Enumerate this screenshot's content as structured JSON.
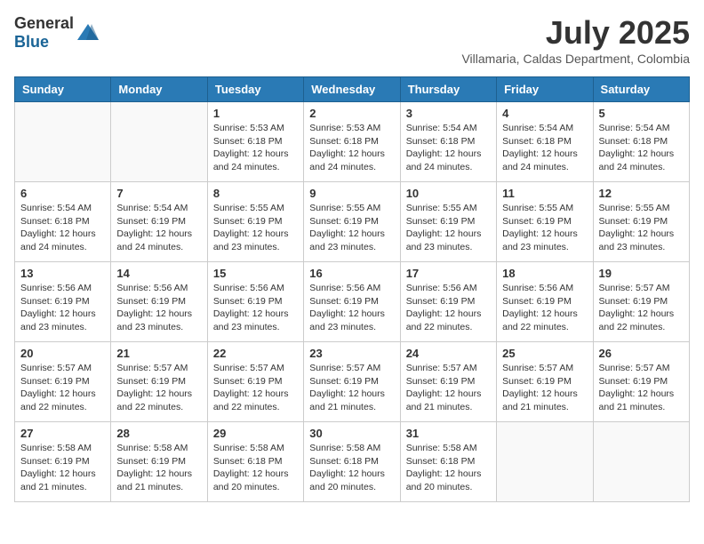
{
  "header": {
    "logo_general": "General",
    "logo_blue": "Blue",
    "title": "July 2025",
    "location": "Villamaria, Caldas Department, Colombia"
  },
  "days_of_week": [
    "Sunday",
    "Monday",
    "Tuesday",
    "Wednesday",
    "Thursday",
    "Friday",
    "Saturday"
  ],
  "weeks": [
    [
      {
        "day": "",
        "sunrise": "",
        "sunset": "",
        "daylight": ""
      },
      {
        "day": "",
        "sunrise": "",
        "sunset": "",
        "daylight": ""
      },
      {
        "day": "1",
        "sunrise": "Sunrise: 5:53 AM",
        "sunset": "Sunset: 6:18 PM",
        "daylight": "Daylight: 12 hours and 24 minutes."
      },
      {
        "day": "2",
        "sunrise": "Sunrise: 5:53 AM",
        "sunset": "Sunset: 6:18 PM",
        "daylight": "Daylight: 12 hours and 24 minutes."
      },
      {
        "day": "3",
        "sunrise": "Sunrise: 5:54 AM",
        "sunset": "Sunset: 6:18 PM",
        "daylight": "Daylight: 12 hours and 24 minutes."
      },
      {
        "day": "4",
        "sunrise": "Sunrise: 5:54 AM",
        "sunset": "Sunset: 6:18 PM",
        "daylight": "Daylight: 12 hours and 24 minutes."
      },
      {
        "day": "5",
        "sunrise": "Sunrise: 5:54 AM",
        "sunset": "Sunset: 6:18 PM",
        "daylight": "Daylight: 12 hours and 24 minutes."
      }
    ],
    [
      {
        "day": "6",
        "sunrise": "Sunrise: 5:54 AM",
        "sunset": "Sunset: 6:18 PM",
        "daylight": "Daylight: 12 hours and 24 minutes."
      },
      {
        "day": "7",
        "sunrise": "Sunrise: 5:54 AM",
        "sunset": "Sunset: 6:19 PM",
        "daylight": "Daylight: 12 hours and 24 minutes."
      },
      {
        "day": "8",
        "sunrise": "Sunrise: 5:55 AM",
        "sunset": "Sunset: 6:19 PM",
        "daylight": "Daylight: 12 hours and 23 minutes."
      },
      {
        "day": "9",
        "sunrise": "Sunrise: 5:55 AM",
        "sunset": "Sunset: 6:19 PM",
        "daylight": "Daylight: 12 hours and 23 minutes."
      },
      {
        "day": "10",
        "sunrise": "Sunrise: 5:55 AM",
        "sunset": "Sunset: 6:19 PM",
        "daylight": "Daylight: 12 hours and 23 minutes."
      },
      {
        "day": "11",
        "sunrise": "Sunrise: 5:55 AM",
        "sunset": "Sunset: 6:19 PM",
        "daylight": "Daylight: 12 hours and 23 minutes."
      },
      {
        "day": "12",
        "sunrise": "Sunrise: 5:55 AM",
        "sunset": "Sunset: 6:19 PM",
        "daylight": "Daylight: 12 hours and 23 minutes."
      }
    ],
    [
      {
        "day": "13",
        "sunrise": "Sunrise: 5:56 AM",
        "sunset": "Sunset: 6:19 PM",
        "daylight": "Daylight: 12 hours and 23 minutes."
      },
      {
        "day": "14",
        "sunrise": "Sunrise: 5:56 AM",
        "sunset": "Sunset: 6:19 PM",
        "daylight": "Daylight: 12 hours and 23 minutes."
      },
      {
        "day": "15",
        "sunrise": "Sunrise: 5:56 AM",
        "sunset": "Sunset: 6:19 PM",
        "daylight": "Daylight: 12 hours and 23 minutes."
      },
      {
        "day": "16",
        "sunrise": "Sunrise: 5:56 AM",
        "sunset": "Sunset: 6:19 PM",
        "daylight": "Daylight: 12 hours and 23 minutes."
      },
      {
        "day": "17",
        "sunrise": "Sunrise: 5:56 AM",
        "sunset": "Sunset: 6:19 PM",
        "daylight": "Daylight: 12 hours and 22 minutes."
      },
      {
        "day": "18",
        "sunrise": "Sunrise: 5:56 AM",
        "sunset": "Sunset: 6:19 PM",
        "daylight": "Daylight: 12 hours and 22 minutes."
      },
      {
        "day": "19",
        "sunrise": "Sunrise: 5:57 AM",
        "sunset": "Sunset: 6:19 PM",
        "daylight": "Daylight: 12 hours and 22 minutes."
      }
    ],
    [
      {
        "day": "20",
        "sunrise": "Sunrise: 5:57 AM",
        "sunset": "Sunset: 6:19 PM",
        "daylight": "Daylight: 12 hours and 22 minutes."
      },
      {
        "day": "21",
        "sunrise": "Sunrise: 5:57 AM",
        "sunset": "Sunset: 6:19 PM",
        "daylight": "Daylight: 12 hours and 22 minutes."
      },
      {
        "day": "22",
        "sunrise": "Sunrise: 5:57 AM",
        "sunset": "Sunset: 6:19 PM",
        "daylight": "Daylight: 12 hours and 22 minutes."
      },
      {
        "day": "23",
        "sunrise": "Sunrise: 5:57 AM",
        "sunset": "Sunset: 6:19 PM",
        "daylight": "Daylight: 12 hours and 21 minutes."
      },
      {
        "day": "24",
        "sunrise": "Sunrise: 5:57 AM",
        "sunset": "Sunset: 6:19 PM",
        "daylight": "Daylight: 12 hours and 21 minutes."
      },
      {
        "day": "25",
        "sunrise": "Sunrise: 5:57 AM",
        "sunset": "Sunset: 6:19 PM",
        "daylight": "Daylight: 12 hours and 21 minutes."
      },
      {
        "day": "26",
        "sunrise": "Sunrise: 5:57 AM",
        "sunset": "Sunset: 6:19 PM",
        "daylight": "Daylight: 12 hours and 21 minutes."
      }
    ],
    [
      {
        "day": "27",
        "sunrise": "Sunrise: 5:58 AM",
        "sunset": "Sunset: 6:19 PM",
        "daylight": "Daylight: 12 hours and 21 minutes."
      },
      {
        "day": "28",
        "sunrise": "Sunrise: 5:58 AM",
        "sunset": "Sunset: 6:19 PM",
        "daylight": "Daylight: 12 hours and 21 minutes."
      },
      {
        "day": "29",
        "sunrise": "Sunrise: 5:58 AM",
        "sunset": "Sunset: 6:18 PM",
        "daylight": "Daylight: 12 hours and 20 minutes."
      },
      {
        "day": "30",
        "sunrise": "Sunrise: 5:58 AM",
        "sunset": "Sunset: 6:18 PM",
        "daylight": "Daylight: 12 hours and 20 minutes."
      },
      {
        "day": "31",
        "sunrise": "Sunrise: 5:58 AM",
        "sunset": "Sunset: 6:18 PM",
        "daylight": "Daylight: 12 hours and 20 minutes."
      },
      {
        "day": "",
        "sunrise": "",
        "sunset": "",
        "daylight": ""
      },
      {
        "day": "",
        "sunrise": "",
        "sunset": "",
        "daylight": ""
      }
    ]
  ]
}
